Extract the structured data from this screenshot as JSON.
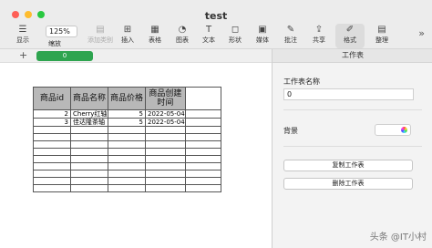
{
  "window": {
    "title": "test"
  },
  "toolbar": {
    "zoom_value": "125%",
    "items": [
      {
        "label": "显示",
        "icon": "☰"
      },
      {
        "label": "缩放",
        "icon": ""
      },
      {
        "label": "添加类别",
        "icon": "▤"
      },
      {
        "label": "插入",
        "icon": "⊞"
      },
      {
        "label": "表格",
        "icon": "▦"
      },
      {
        "label": "图表",
        "icon": "◔"
      },
      {
        "label": "文本",
        "icon": "T"
      },
      {
        "label": "形状",
        "icon": "◻"
      },
      {
        "label": "媒体",
        "icon": "▣"
      },
      {
        "label": "批注",
        "icon": "✎"
      },
      {
        "label": "共享",
        "icon": "⇪"
      },
      {
        "label": "格式",
        "icon": "✐"
      },
      {
        "label": "整理",
        "icon": "▤"
      }
    ],
    "more": "»"
  },
  "sheets": {
    "add": "+",
    "active_tab": "0"
  },
  "table": {
    "headers": [
      "商品id",
      "商品名称",
      "商品价格",
      "商品创建时间"
    ],
    "rows": [
      [
        "2",
        "Cherry红轴",
        "5",
        "2022-05-04"
      ],
      [
        "3",
        "佳达隆茶轴",
        "5",
        "2022-05-04"
      ],
      [
        "",
        "",
        "",
        ""
      ],
      [
        "",
        "",
        "",
        ""
      ],
      [
        "",
        "",
        "",
        ""
      ],
      [
        "",
        "",
        "",
        ""
      ],
      [
        "",
        "",
        "",
        ""
      ],
      [
        "",
        "",
        "",
        ""
      ],
      [
        "",
        "",
        "",
        ""
      ],
      [
        "",
        "",
        "",
        ""
      ],
      [
        "",
        "",
        "",
        ""
      ]
    ]
  },
  "inspector": {
    "header": "工作表",
    "name_label": "工作表名称",
    "name_value": "0",
    "background_label": "背景",
    "duplicate_button": "复制工作表",
    "delete_button": "删除工作表"
  },
  "watermark": "头条 @IT小村"
}
